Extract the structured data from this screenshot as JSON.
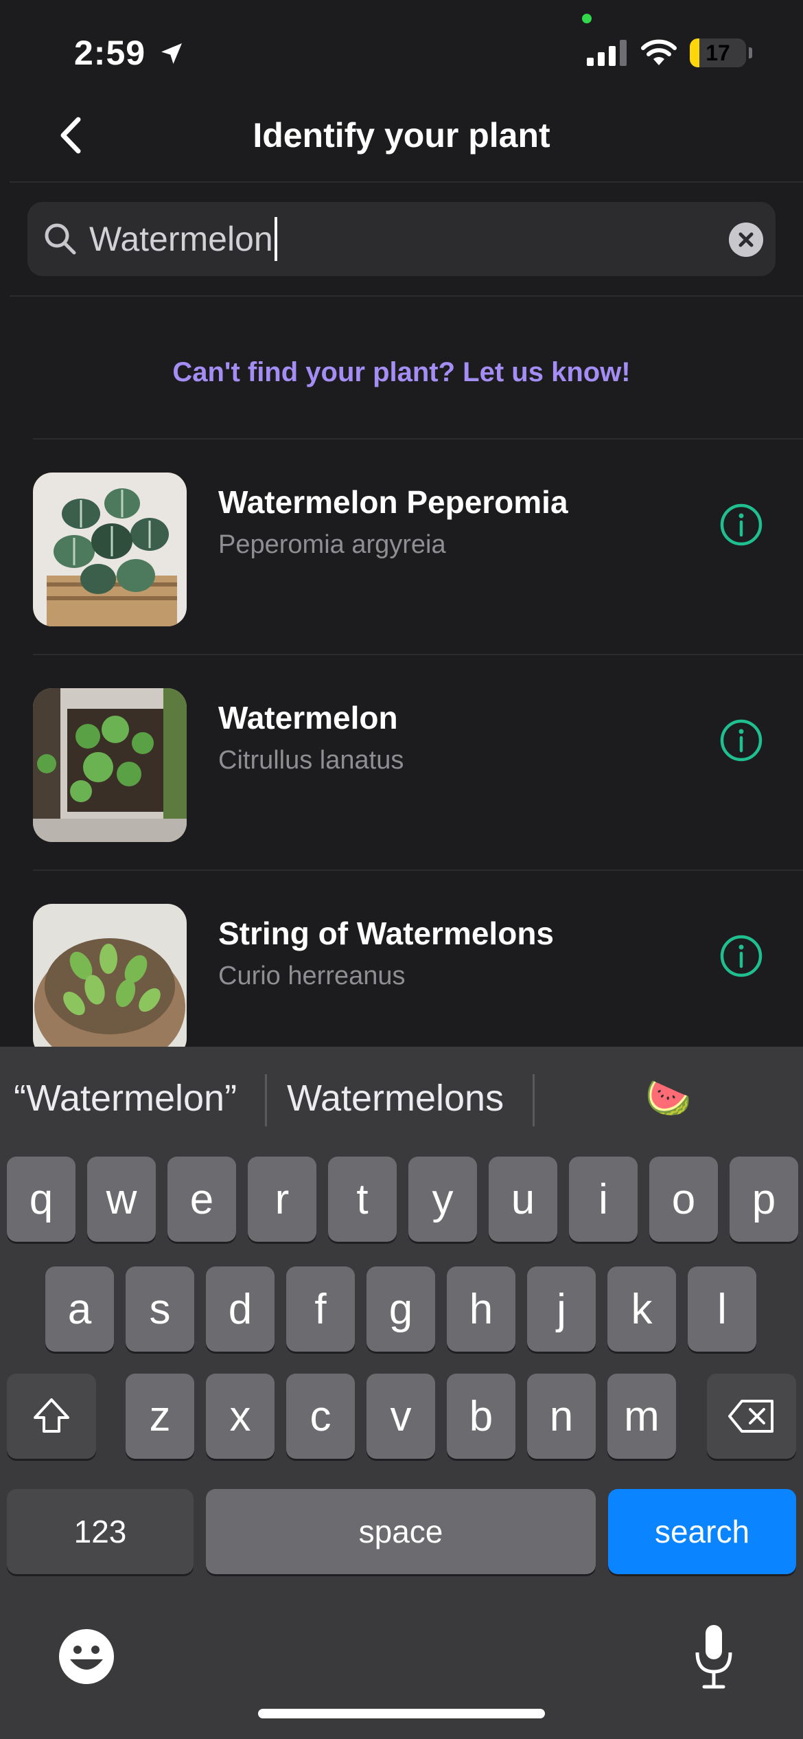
{
  "status_bar": {
    "time": "2:59",
    "battery": "17",
    "battery_level": 0.17
  },
  "nav": {
    "title": "Identify your plant"
  },
  "search": {
    "value": "Watermelon"
  },
  "feedback_link": "Can't find your plant? Let us know!",
  "plants": [
    {
      "name": "Watermelon Peperomia",
      "scientific": "Peperomia argyreia"
    },
    {
      "name": "Watermelon",
      "scientific": "Citrullus lanatus"
    },
    {
      "name": "String of Watermelons",
      "scientific": "Curio herreanus"
    }
  ],
  "keyboard": {
    "suggestions": [
      "“Watermelon”",
      "Watermelons",
      "🍉"
    ],
    "row1": [
      "q",
      "w",
      "e",
      "r",
      "t",
      "y",
      "u",
      "i",
      "o",
      "p"
    ],
    "row2": [
      "a",
      "s",
      "d",
      "f",
      "g",
      "h",
      "j",
      "k",
      "l"
    ],
    "row3": [
      "z",
      "x",
      "c",
      "v",
      "b",
      "n",
      "m"
    ],
    "numbers_label": "123",
    "space_label": "space",
    "search_label": "search"
  },
  "colors": {
    "accent_purple": "#a48ef5",
    "info_green": "#1fbf8f",
    "key_blue": "#0a84ff"
  }
}
